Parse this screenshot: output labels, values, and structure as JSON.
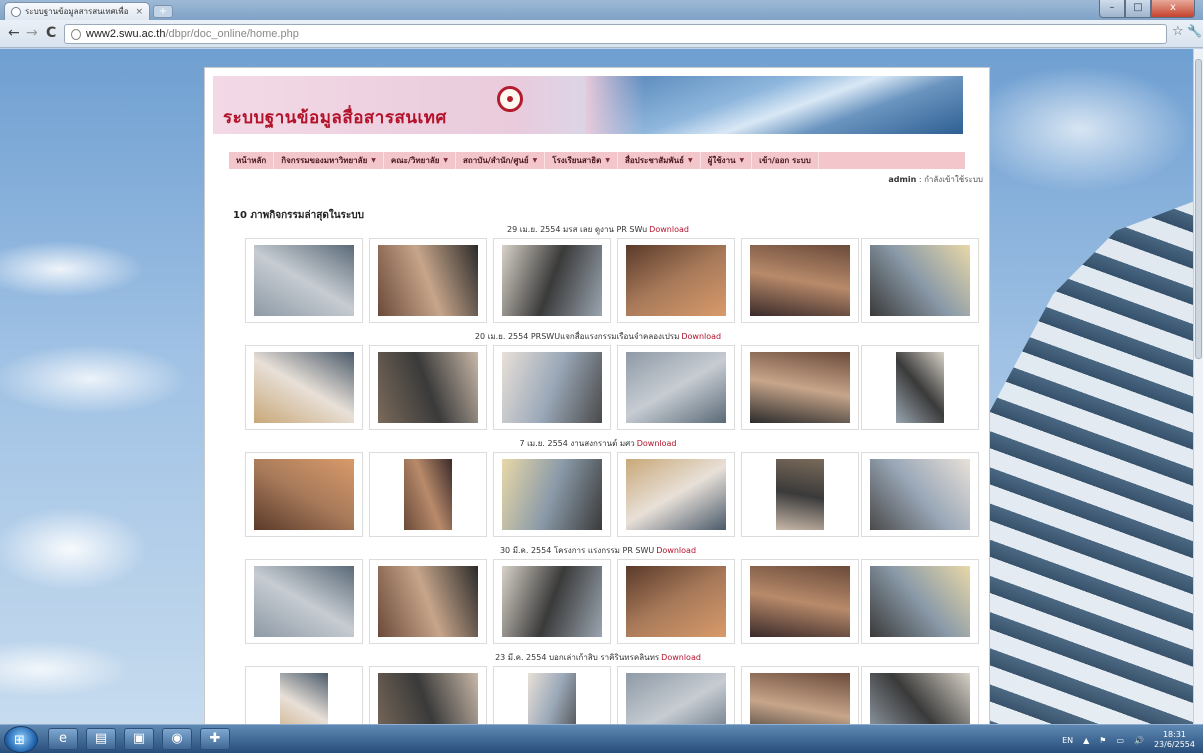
{
  "browser": {
    "tab_title": "ระบบฐานข้อมูลสารสนเทศเพื่อ",
    "tab_close": "×",
    "new_tab": "+",
    "url_host": "www2.swu.ac.th",
    "url_path": "/dbpr/doc_online/home.php",
    "back": "←",
    "forward": "→",
    "reload": "C",
    "bookmark_icon": "star-icon",
    "menu_icon": "wrench-icon",
    "window_minimize": "–",
    "window_maximize": "□",
    "window_close": "x"
  },
  "site": {
    "title": "ระบบฐานข้อมูลสื่อสารสนเทศ",
    "menu": [
      {
        "label": "หน้าหลัก",
        "dropdown": false
      },
      {
        "label": "กิจกรรมของมหาวิทยาลัย",
        "dropdown": true
      },
      {
        "label": "คณะ/วิทยาลัย",
        "dropdown": true
      },
      {
        "label": "สถาบัน/สำนัก/ศูนย์",
        "dropdown": true
      },
      {
        "label": "โรงเรียนสาธิต",
        "dropdown": true
      },
      {
        "label": "สื่อประชาสัมพันธ์",
        "dropdown": true
      },
      {
        "label": "ผู้ใช้งาน",
        "dropdown": true
      },
      {
        "label": "เข้า/ออก ระบบ",
        "dropdown": false
      }
    ],
    "user": "admin",
    "user_status": " : กำลังเข้าใช้ระบบ",
    "section_title": "10 ภาพกิจกรรมล่าสุดในระบบ",
    "download_label": "Download",
    "groups": [
      {
        "caption": "29 เม.ย. 2554 มรส เลย ดูงาน PR SWu"
      },
      {
        "caption": "20 เม.ย. 2554 PRSWUแจกสื่อแรงกรรมเรือนจำคลองเปรม"
      },
      {
        "caption": "7 เม.ย. 2554 งานสงกรานต์ มศว"
      },
      {
        "caption": "30 มี.ค. 2554 โครงการ แรงกรรม PR SWU"
      },
      {
        "caption": "23 มี.ค. 2554 บอกเล่าเก้าสิบ ราคิรินทรคลินทร"
      }
    ]
  },
  "taskbar": {
    "start_glyph": "⊞",
    "apps": [
      "e",
      "▤",
      "▣",
      "◉",
      "✚"
    ],
    "lang": "EN",
    "time": "18:31",
    "date": "23/6/2554"
  },
  "colors": {
    "brand_red": "#b3122b",
    "menu_pink": "#f3c6cc"
  }
}
